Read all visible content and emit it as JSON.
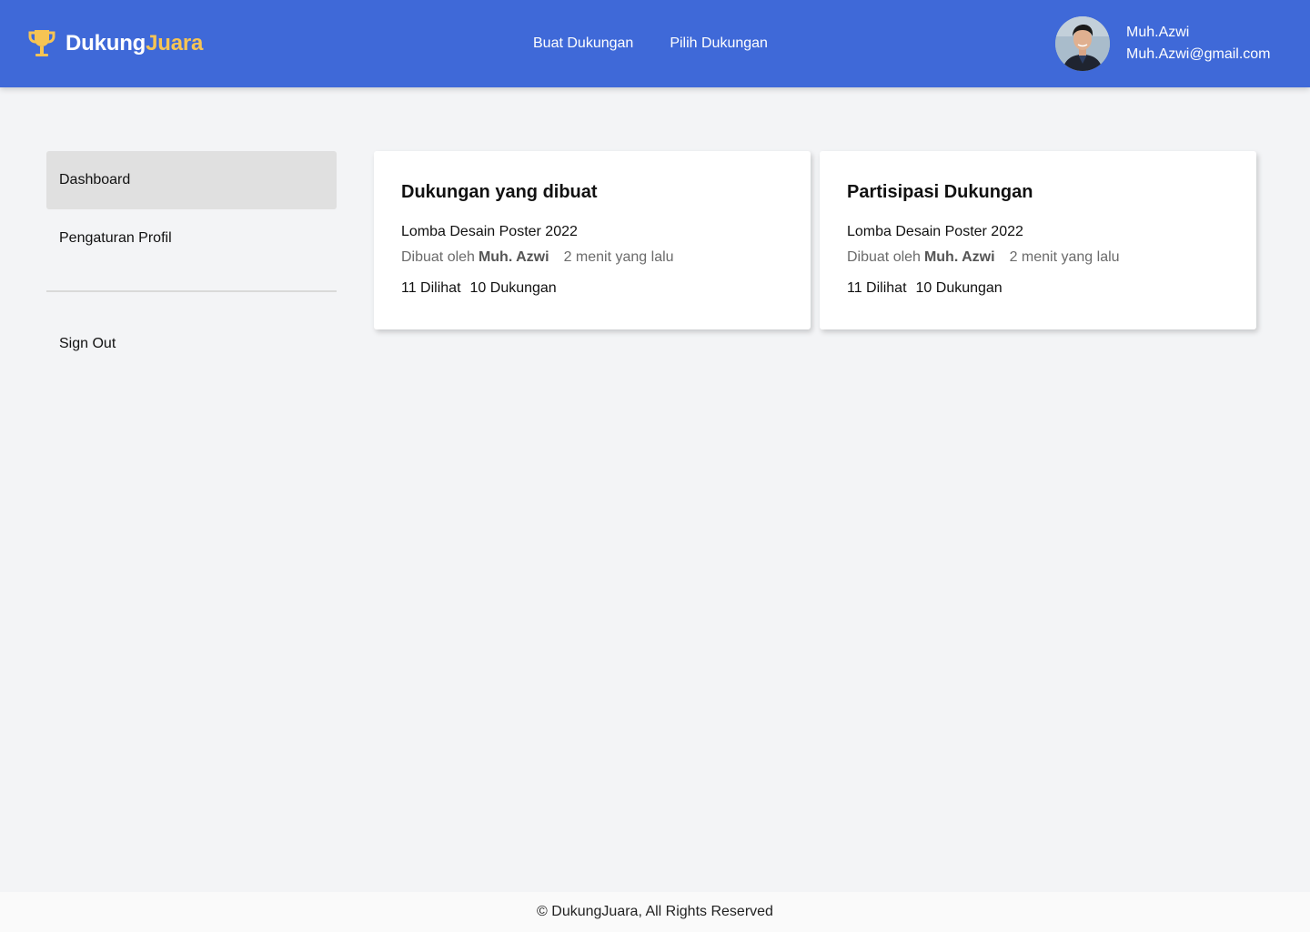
{
  "brand": {
    "part1": "Dukung",
    "part2": "Juara",
    "icon": "trophy-icon"
  },
  "nav": [
    {
      "label": "Buat Dukungan"
    },
    {
      "label": "Pilih Dukungan"
    }
  ],
  "user": {
    "name": "Muh.Azwi",
    "email": "Muh.Azwi@gmail.com",
    "avatar": "avatar-photo"
  },
  "sidebar": {
    "items": [
      {
        "label": "Dashboard",
        "active": true
      },
      {
        "label": "Pengaturan Profil",
        "active": false
      }
    ],
    "signout_label": "Sign Out"
  },
  "cards": [
    {
      "title": "Dukungan yang dibuat",
      "item_title": "Lomba Desain Poster 2022",
      "created_by_label": "Dibuat oleh",
      "author": "Muh. Azwi",
      "time": "2 menit yang lalu",
      "views": "11 Dilihat",
      "supports": "10 Dukungan"
    },
    {
      "title": "Partisipasi Dukungan",
      "item_title": "Lomba Desain Poster 2022",
      "created_by_label": "Dibuat oleh",
      "author": "Muh. Azwi",
      "time": "2 menit yang lalu",
      "views": "11 Dilihat",
      "supports": "10 Dukungan"
    }
  ],
  "footer": {
    "text": "© DukungJuara, All Rights Reserved"
  },
  "colors": {
    "header": "#3f69d8",
    "brand_accent": "#f6c454",
    "background": "#f3f4f6",
    "active_item": "#e0e0e0"
  }
}
